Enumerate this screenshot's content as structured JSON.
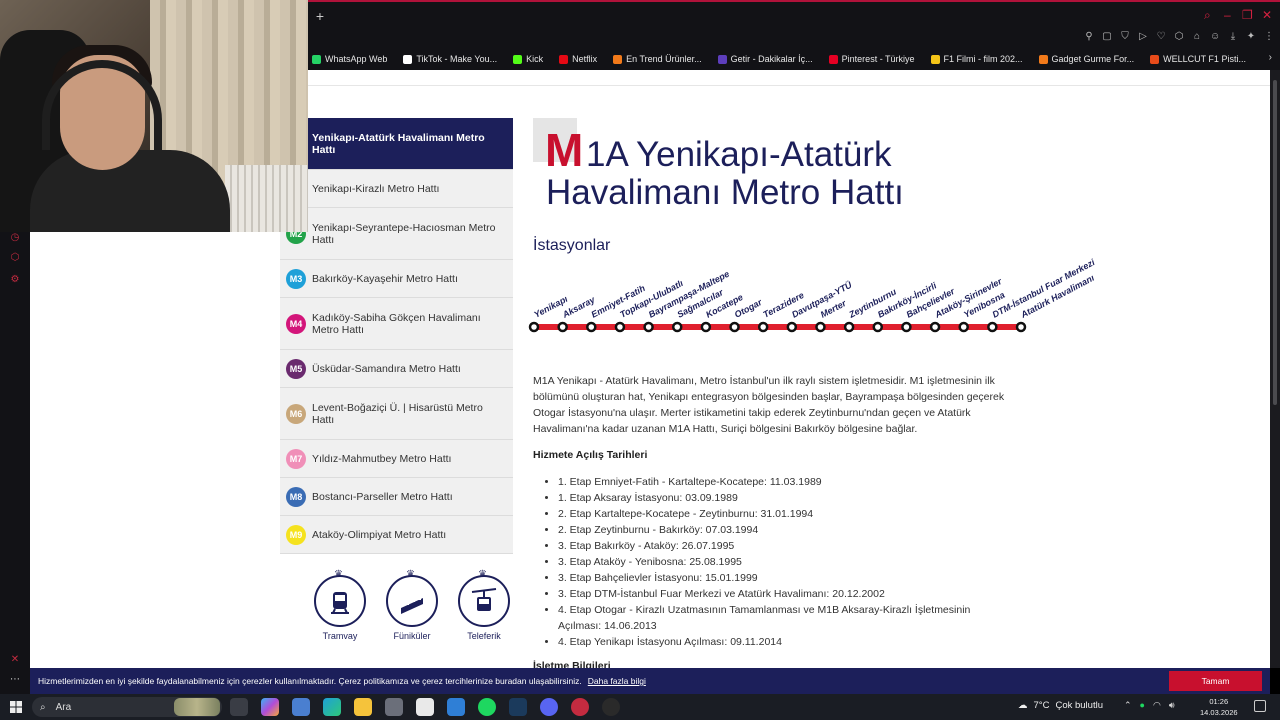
{
  "browser": {
    "new_tab": "+",
    "bookmarks": [
      {
        "label": "WhatsApp Web",
        "color": "#25d366"
      },
      {
        "label": "TikTok - Make You...",
        "color": "#ffffff"
      },
      {
        "label": "Kick",
        "color": "#53fc18"
      },
      {
        "label": "Netflix",
        "color": "#e50914"
      },
      {
        "label": "En Trend Ürünler...",
        "color": "#f27a1a"
      },
      {
        "label": "Getir - Dakikalar İç...",
        "color": "#5d3ebc"
      },
      {
        "label": "Pinterest - Türkiye",
        "color": "#e60023"
      },
      {
        "label": "F1 Filmi - film 202...",
        "color": "#f5c518"
      },
      {
        "label": "Gadget Gurme For...",
        "color": "#f27a1a"
      },
      {
        "label": "WELLCUT F1 Pisti...",
        "color": "#e84b1a"
      }
    ]
  },
  "sidebar": {
    "lines": [
      {
        "badge": "",
        "label": "Yenikapı-Atatürk Havalimanı Metro Hattı",
        "color": "#1c1f5a",
        "active": true
      },
      {
        "badge": "",
        "label": "Yenikapı-Kirazlı Metro Hattı",
        "color": "",
        "active": false
      },
      {
        "badge": "M2",
        "label": "Yenikapı-Seyrantepe-Hacıosman Metro Hattı",
        "color": "#22a34a",
        "active": false
      },
      {
        "badge": "M3",
        "label": "Bakırköy-Kayaşehir Metro Hattı",
        "color": "#1ea0d8",
        "active": false
      },
      {
        "badge": "M4",
        "label": "Kadıköy-Sabiha Gökçen Havalimanı Metro Hattı",
        "color": "#d3157a",
        "active": false
      },
      {
        "badge": "M5",
        "label": "Üsküdar-Samandıra Metro Hattı",
        "color": "#6a2a6e",
        "active": false
      },
      {
        "badge": "M6",
        "label": "Levent-Boğaziçi Ü. | Hisarüstü Metro Hattı",
        "color": "#c8a77a",
        "active": false
      },
      {
        "badge": "M7",
        "label": "Yıldız-Mahmutbey Metro Hattı",
        "color": "#f08fb8",
        "active": false
      },
      {
        "badge": "M8",
        "label": "Bostancı-Parseller Metro Hattı",
        "color": "#3a6cb4",
        "active": false
      },
      {
        "badge": "M9",
        "label": "Ataköy-Olimpiyat Metro Hattı",
        "color": "#f5e21e",
        "active": false
      }
    ],
    "transport": [
      {
        "label": "Tramvay",
        "icon": "tram-icon"
      },
      {
        "label": "Füniküler",
        "icon": "funicular-icon"
      },
      {
        "label": "Teleferik",
        "icon": "cable-car-icon"
      }
    ]
  },
  "main": {
    "logo_letter": "M",
    "title_line1": "1A Yenikapı-Atatürk",
    "title_line2": "Havalimanı Metro Hattı",
    "stations_heading": "İstasyonlar",
    "line_color": "#e0202e",
    "stations": [
      "Yenikapı",
      "Aksaray",
      "Emniyet-Fatih",
      "Topkapı-Ulubatlı",
      "Bayrampaşa-Maltepe",
      "Sağmalcılar",
      "Kocatepe",
      "Otogar",
      "Terazidere",
      "Davutpaşa-YTÜ",
      "Merter",
      "Zeytinburnu",
      "Bakırköy-İncirli",
      "Bahçelievler",
      "Ataköy-Şirinevler",
      "Yenibosna",
      "DTM-İstanbul Fuar Merkezi",
      "Atatürk Havalimanı"
    ],
    "description": "M1A Yenikapı - Atatürk Havalimanı, Metro İstanbul'un ilk raylı sistem işletmesidir. M1 işletmesinin ilk bölümünü oluşturan hat, Yenikapı entegrasyon bölgesinden başlar, Bayrampaşa bölgesinden geçerek Otogar İstasyonu'na ulaşır. Merter istikametini takip ederek Zeytinburnu'ndan geçen ve Atatürk Havalimanı'na kadar uzanan M1A Hattı, Suriçi bölgesini Bakırköy bölgesine bağlar.",
    "opening_heading": "Hizmete Açılış Tarihleri",
    "openings": [
      "1. Etap Emniyet-Fatih - Kartaltepe-Kocatepe: 11.03.1989",
      "1. Etap Aksaray İstasyonu: 03.09.1989",
      "2. Etap Kartaltepe-Kocatepe - Zeytinburnu: 31.01.1994",
      "2. Etap Zeytinburnu - Bakırköy: 07.03.1994",
      "3. Etap Bakırköy - Ataköy: 26.07.1995",
      "3. Etap Ataköy - Yenibosna: 25.08.1995",
      "3. Etap Bahçelievler İstasyonu: 15.01.1999",
      "3. Etap DTM-İstanbul Fuar Merkezi ve Atatürk Havalimanı: 20.12.2002",
      "4. Etap Otogar - Kirazlı Uzatmasının Tamamlanması ve M1B Aksaray-Kirazlı İşletmesinin Açılması: 14.06.2013",
      "4. Etap Yenikapı İstasyonu Açılması: 09.11.2014"
    ],
    "next_heading": "İşletme Bilgileri"
  },
  "cookie": {
    "text": "Hizmetlerimizden en iyi şekilde faydalanabilmeniz için çerezler kullanılmaktadır. Çerez politikamıza ve çerez tercihlerinize buradan ulaşabilirsiniz.",
    "link": "Daha fazla bilgi",
    "button": "Tamam",
    "bg_color": "#1c1f5a",
    "button_color": "#c8102e"
  },
  "taskbar": {
    "search_placeholder": "Ara",
    "weather_temp": "7°C",
    "weather_text": "Çok bulutlu",
    "time": "01:26",
    "date": "14.03.2026"
  }
}
